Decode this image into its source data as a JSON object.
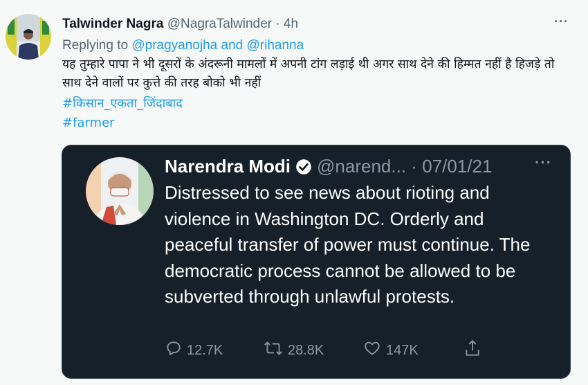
{
  "tweet": {
    "author_name": "Talwinder Nagra",
    "handle": "@NagraTalwinder",
    "separator": "·",
    "time": "4h",
    "more_label": "···",
    "replying_prefix": "Replying to",
    "reply_to_1": "@pragyanojha",
    "reply_joiner": "and",
    "reply_to_2": "@rihanna",
    "text": "यह तुम्हारे पापा ने भी दूसरों के अंदरूनी मामलों में अपनी टांग लड़ाई थी अगर साथ देने की हिम्मत नहीं है हिजड़े तो साथ देने वालों पर कुत्ते की तरह बोको भी नहीं",
    "hashtag_1": "#किसान_एकता_जिंदाबाद",
    "hashtag_2": "#farmer"
  },
  "quoted": {
    "author_name": "Narendra Modi",
    "handle": "@narend...",
    "separator": "·",
    "date": "07/01/21",
    "more_label": "···",
    "text": "Distressed to see news about rioting and violence in Washington DC. Orderly and peaceful transfer of power must continue. The democratic process cannot be allowed to be subverted through unlawful protests.",
    "replies": "12.7K",
    "retweets": "28.8K",
    "likes": "147K"
  },
  "icons": {
    "verified": "verified-badge-icon",
    "reply": "reply-icon",
    "retweet": "retweet-icon",
    "like": "heart-icon",
    "share": "share-icon"
  },
  "colors": {
    "link": "#1d9bf0",
    "quote_background": "#15202b",
    "muted": "#536471",
    "muted_dark": "#8b98a5"
  }
}
